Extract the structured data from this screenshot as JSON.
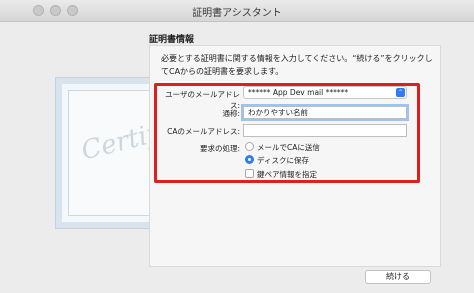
{
  "window": {
    "title": "証明書アシスタント"
  },
  "section": {
    "heading": "証明書情報",
    "description": "必要とする証明書に関する情報を入力してください。“続ける”をクリックしてCAからの証明書を要求します。"
  },
  "form": {
    "email_label": "ユーザのメールアドレス:",
    "email_value": "****** App Dev mail ******",
    "name_label": "通称:",
    "name_value": "わかりやすい名前",
    "ca_label": "CAのメールアドレス:",
    "ca_value": "",
    "request_label": "要求の処理:",
    "options": [
      {
        "label": "メールでCAに送信",
        "selected": false
      },
      {
        "label": "ディスクに保存",
        "selected": true
      }
    ],
    "keypair_label": "鍵ペア情報を指定",
    "keypair_checked": false
  },
  "footer": {
    "continue_label": "続ける"
  },
  "decor": {
    "cert_script": "Certificate"
  },
  "colors": {
    "accent": "#2f7cf6",
    "highlight": "#e01e1e"
  },
  "icons": {
    "select": "chevron-updown-icon"
  }
}
